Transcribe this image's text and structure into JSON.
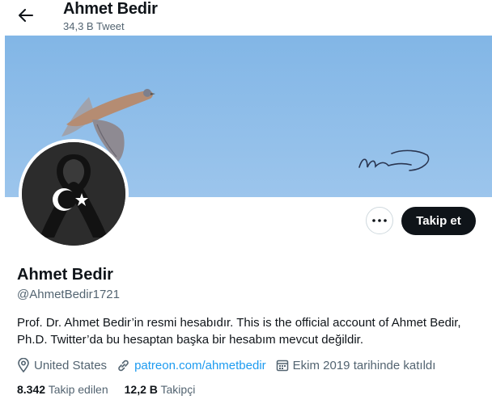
{
  "header": {
    "title": "Ahmet Bedir",
    "tweet_count": "34,3 B Tweet"
  },
  "profile": {
    "name": "Ahmet Bedir",
    "handle": "@AhmetBedir1721",
    "bio": "Prof. Dr. Ahmet Bedir’in resmi hesabıdır. This is the official account of Ahmet Bedir, Ph.D. Twitter’da bu hesaptan başka bir hesabım mevcut değildir.",
    "location": "United States",
    "website": "patreon.com/ahmetbedir",
    "joined": "Ekim 2019 tarihinde katıldı",
    "following_count": "8.342",
    "following_label": "Takip edilen",
    "followers_count": "12,2 B",
    "followers_label": "Takipçi"
  },
  "actions": {
    "follow_label": "Takip et"
  },
  "icons": {
    "back": "arrow-left-icon",
    "more": "more-dots-icon",
    "location": "location-pin-icon",
    "website": "link-icon",
    "joined": "calendar-icon"
  },
  "colors": {
    "link": "#1d9bf0",
    "banner_sky": "#8bbbe8",
    "follow_button": "#0f1419"
  }
}
